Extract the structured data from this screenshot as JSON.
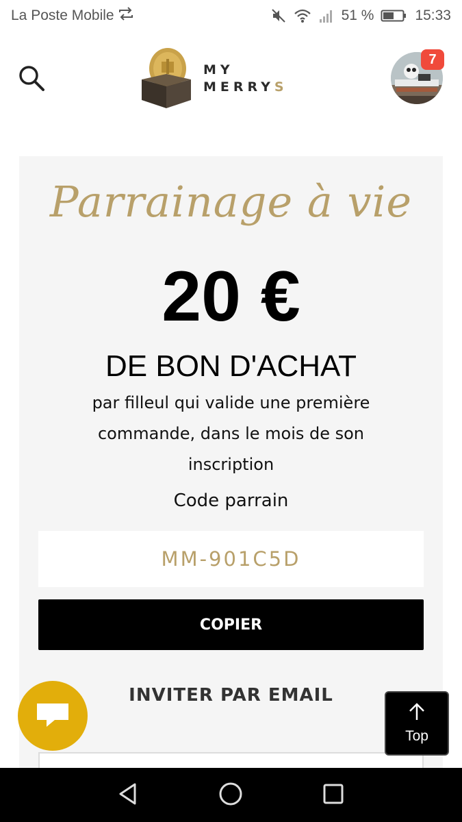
{
  "status_bar": {
    "carrier": "La Poste Mobile",
    "battery": "51 %",
    "time": "15:33",
    "icons": [
      "sync-icon",
      "mute-icon",
      "wifi-icon",
      "signal-icon",
      "battery-icon"
    ]
  },
  "header": {
    "logo_line1": "MY",
    "logo_line2": "MERRY",
    "logo_line2_accent": "S",
    "notification_count": "7"
  },
  "referral": {
    "title": "Parrainage à vie",
    "amount": "20 €",
    "amount_subtitle": "DE BON D'ACHAT",
    "description": "par filleul qui valide une première commande, dans le mois de son inscription",
    "code_label": "Code parrain",
    "code_value": "MM-901C5D",
    "copy_label": "COPIER",
    "invite_heading": "INVITER PAR EMAIL"
  },
  "floating": {
    "top_label": "Top"
  },
  "colors": {
    "gold": "#b8a06a",
    "card_bg": "#f5f5f5",
    "chat_yellow": "#e2ae0b",
    "badge_red": "#f04a3b"
  }
}
